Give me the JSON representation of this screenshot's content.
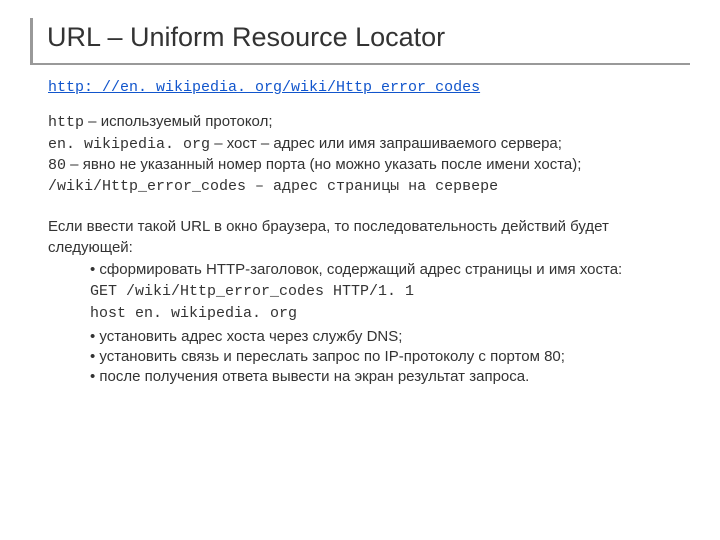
{
  "title": "URL – Uniform Resource Locator",
  "url_link": "http: //en. wikipedia. org/wiki/Http_error_codes",
  "components": {
    "protocol": {
      "term": "http",
      "desc": " – используемый протокол;"
    },
    "host": {
      "term": "en. wikipedia. org",
      "desc": " – хост – адрес или имя запрашиваемого сервера;"
    },
    "port": {
      "term": "80",
      "desc": " – явно не указанный номер порта (но можно указать после имени хоста);"
    },
    "path": {
      "term": "/wiki/Http_error_codes",
      "desc": " – адрес страницы на сервере"
    }
  },
  "sequence_intro": "Если ввести такой URL в окно браузера, то последовательность действий будет следующей:",
  "bullets": {
    "b1": "сформировать HTTP-заголовок, содержащий адрес страницы и имя хоста:",
    "b2": "установить адрес хоста через службу DNS;",
    "b3": "установить связь и переслать запрос по IP-протоколу с портом 80;",
    "b4": "после получения ответа вывести на экран результат запроса."
  },
  "http_request": {
    "line1": "GET /wiki/Http_error_codes HTTP/1. 1",
    "line2": "host en. wikipedia. org"
  }
}
